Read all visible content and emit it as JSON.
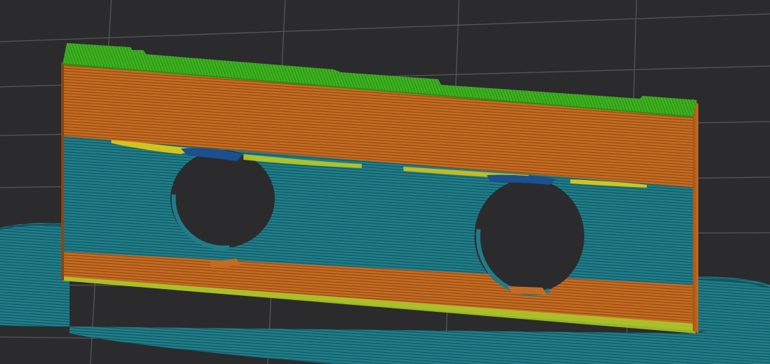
{
  "viewport": {
    "background_color": "#2b2b2e",
    "grid_line_color": "#56565a",
    "grid_visible": true
  },
  "model": {
    "feature_colors": {
      "perimeter_shell": "#c56b21",
      "top_solid_infill": "#3db01f",
      "overhang_perimeter": "#1d6e7c",
      "bridge_infill": "#1b4f8f",
      "gap_fill": "#d2c41c",
      "skirt_brim": "#1f7c84",
      "first_layer_edge": "#a9cf2a"
    },
    "holes": 2
  }
}
